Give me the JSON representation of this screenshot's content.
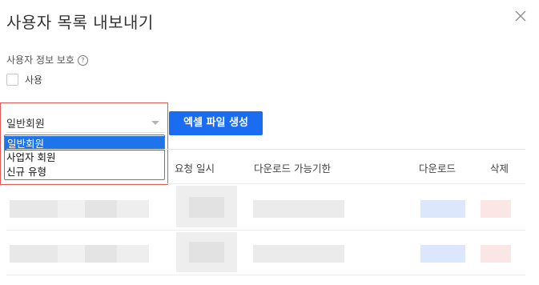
{
  "dialog": {
    "title": "사용자 목록 내보내기",
    "close_icon": "close-icon"
  },
  "privacy": {
    "label": "사용자 정보 보호",
    "help_glyph": "?",
    "checkbox_label": "사용",
    "checked": false
  },
  "member_select": {
    "value": "일반회원",
    "options": [
      "일반회원",
      "사업자 회원",
      "신규 유형"
    ],
    "selected_index": 0
  },
  "actions": {
    "create_excel": "엑셀 파일 생성"
  },
  "table": {
    "columns": [
      "요청 일시",
      "다운로드 가능기한",
      "다운로드",
      "삭제"
    ]
  },
  "colors": {
    "primary": "#1a6cf0",
    "option_highlight": "#1e74e8",
    "focus_outline": "#e05a5a"
  }
}
